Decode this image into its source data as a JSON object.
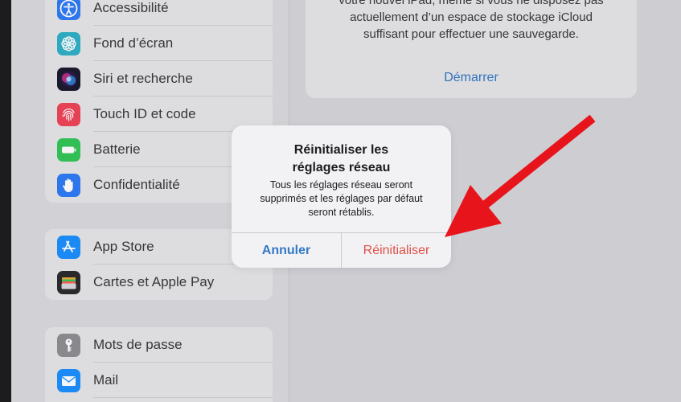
{
  "sidebar": {
    "group1": [
      {
        "label": "Accessibilité",
        "icon": "accessibility-icon",
        "color": "#2f7bf6"
      },
      {
        "label": "Fond d’écran",
        "icon": "flower-icon",
        "color": "#30b0c7"
      },
      {
        "label": "Siri et recherche",
        "icon": "siri-icon",
        "color": "#1c1c2e"
      },
      {
        "label": "Touch ID et code",
        "icon": "fingerprint-icon",
        "color": "#f0455a"
      },
      {
        "label": "Batterie",
        "icon": "battery-icon",
        "color": "#34c759"
      },
      {
        "label": "Confidentialité",
        "icon": "hand-icon",
        "color": "#2f7bf6"
      }
    ],
    "group2": [
      {
        "label": "App Store",
        "icon": "app-store-icon",
        "color": "#1e90ff"
      },
      {
        "label": "Cartes et Apple Pay",
        "icon": "wallet-icon",
        "color": "#2c2c2e"
      }
    ],
    "group3": [
      {
        "label": "Mots de passe",
        "icon": "key-icon",
        "color": "#8e8e93"
      },
      {
        "label": "Mail",
        "icon": "mail-icon",
        "color": "#1e90ff"
      }
    ]
  },
  "card": {
    "lines": [
      "votre nouvel iPad, même si vous ne disposez pas",
      "actuellement d’un espace de stockage iCloud",
      "suffisant pour effectuer une sauvegarde."
    ],
    "link": "Démarrer"
  },
  "alert": {
    "title_lines": [
      "Réinitialiser les",
      "réglages réseau"
    ],
    "message_lines": [
      "Tous les réglages réseau seront",
      "supprimés et les réglages par défaut",
      "seront rétablis."
    ],
    "cancel_label": "Annuler",
    "reset_label": "Réinitialiser"
  },
  "colors": {
    "accent": "#3478c6",
    "destructive": "#e0504a",
    "arrow": "#e8141b"
  }
}
